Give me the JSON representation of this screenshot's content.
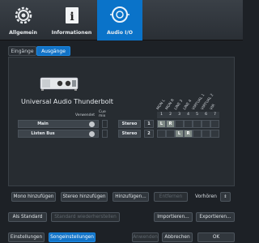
{
  "toolbar": {
    "items": [
      {
        "label": "Allgemein",
        "icon": "gear-icon"
      },
      {
        "label": "Informationen",
        "icon": "info-icon"
      },
      {
        "label": "Audio I/O",
        "icon": "audio-io-icon"
      }
    ],
    "active": "Audio I/O"
  },
  "tabs": [
    "Eingänge",
    "Ausgänge"
  ],
  "active_tab": "Ausgänge",
  "device": {
    "name": "Universal Audio Thunderbolt"
  },
  "columns": {
    "used": "Verwendet",
    "cue_mix": "Cue\nmix"
  },
  "outputs": [
    {
      "name": "Main",
      "type": "Stereo",
      "index": "1",
      "left_index": 1
    },
    {
      "name": "Listen Bus",
      "type": "Stereo",
      "index": "2",
      "left_index": 3
    }
  ],
  "channel_numbers": [
    "1",
    "2",
    "3",
    "4",
    "5",
    "6",
    "7"
  ],
  "channel_labels": [
    "MON L",
    "MON R",
    "LINE 3",
    "LINE 4",
    "VIRTUAL 1",
    "VIRTUAL 2",
    "VIR"
  ],
  "cell_labels": {
    "left": "L",
    "right": "R"
  },
  "actions": {
    "mono_add": "Mono hinzufügen",
    "stereo_add": "Stereo hinzufügen",
    "add_more": "Hinzufügen...",
    "remove": "Entfernen",
    "presets_label": "Vorhören",
    "set_default": "Als Standard",
    "restore_default": "Standard wiederherstellen",
    "import": "Importieren...",
    "export": "Exportieren..."
  },
  "footer": {
    "settings": "Einstellungen",
    "song_settings": "Songeinstellungen",
    "apply": "Anwenden",
    "cancel": "Abbrechen",
    "ok": "OK"
  }
}
